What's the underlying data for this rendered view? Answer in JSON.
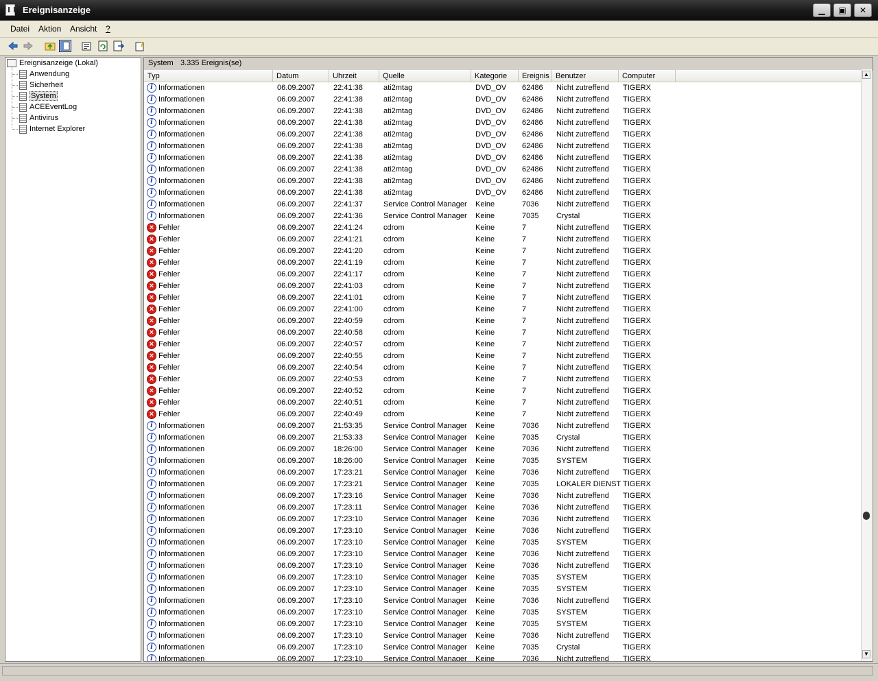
{
  "window": {
    "title": "Ereignisanzeige",
    "buttons": {
      "minimize": "▁",
      "maximize": "▣",
      "close": "✕"
    }
  },
  "menu": {
    "items": [
      {
        "label": "Datei",
        "accel": "D"
      },
      {
        "label": "Aktion",
        "accel": "k"
      },
      {
        "label": "Ansicht",
        "accel": "A"
      },
      {
        "label": "?",
        "accel": "?"
      }
    ]
  },
  "toolbar": {
    "icons": [
      "back-arrow-icon",
      "forward-arrow-icon",
      "up-folder-icon",
      "show-hide-tree-icon",
      "properties-icon",
      "refresh-icon",
      "export-list-icon",
      "help-icon"
    ]
  },
  "tree": {
    "root": "Ereignisanzeige (Lokal)",
    "items": [
      "Anwendung",
      "Sicherheit",
      "System",
      "ACEEventLog",
      "Antivirus",
      "Internet Explorer"
    ],
    "selected": "System"
  },
  "header": {
    "log_name": "System",
    "count_text": "3.335 Ereignis(se)"
  },
  "columns": [
    "Typ",
    "Datum",
    "Uhrzeit",
    "Quelle",
    "Kategorie",
    "Ereignis",
    "Benutzer",
    "Computer"
  ],
  "rows": [
    [
      "Informationen",
      "06.09.2007",
      "22:41:38",
      "ati2mtag",
      "DVD_OV",
      "62486",
      "Nicht zutreffend",
      "TIGERX"
    ],
    [
      "Informationen",
      "06.09.2007",
      "22:41:38",
      "ati2mtag",
      "DVD_OV",
      "62486",
      "Nicht zutreffend",
      "TIGERX"
    ],
    [
      "Informationen",
      "06.09.2007",
      "22:41:38",
      "ati2mtag",
      "DVD_OV",
      "62486",
      "Nicht zutreffend",
      "TIGERX"
    ],
    [
      "Informationen",
      "06.09.2007",
      "22:41:38",
      "ati2mtag",
      "DVD_OV",
      "62486",
      "Nicht zutreffend",
      "TIGERX"
    ],
    [
      "Informationen",
      "06.09.2007",
      "22:41:38",
      "ati2mtag",
      "DVD_OV",
      "62486",
      "Nicht zutreffend",
      "TIGERX"
    ],
    [
      "Informationen",
      "06.09.2007",
      "22:41:38",
      "ati2mtag",
      "DVD_OV",
      "62486",
      "Nicht zutreffend",
      "TIGERX"
    ],
    [
      "Informationen",
      "06.09.2007",
      "22:41:38",
      "ati2mtag",
      "DVD_OV",
      "62486",
      "Nicht zutreffend",
      "TIGERX"
    ],
    [
      "Informationen",
      "06.09.2007",
      "22:41:38",
      "ati2mtag",
      "DVD_OV",
      "62486",
      "Nicht zutreffend",
      "TIGERX"
    ],
    [
      "Informationen",
      "06.09.2007",
      "22:41:38",
      "ati2mtag",
      "DVD_OV",
      "62486",
      "Nicht zutreffend",
      "TIGERX"
    ],
    [
      "Informationen",
      "06.09.2007",
      "22:41:38",
      "ati2mtag",
      "DVD_OV",
      "62486",
      "Nicht zutreffend",
      "TIGERX"
    ],
    [
      "Informationen",
      "06.09.2007",
      "22:41:37",
      "Service Control Manager",
      "Keine",
      "7036",
      "Nicht zutreffend",
      "TIGERX"
    ],
    [
      "Informationen",
      "06.09.2007",
      "22:41:36",
      "Service Control Manager",
      "Keine",
      "7035",
      "Crystal",
      "TIGERX"
    ],
    [
      "Fehler",
      "06.09.2007",
      "22:41:24",
      "cdrom",
      "Keine",
      "7",
      "Nicht zutreffend",
      "TIGERX"
    ],
    [
      "Fehler",
      "06.09.2007",
      "22:41:21",
      "cdrom",
      "Keine",
      "7",
      "Nicht zutreffend",
      "TIGERX"
    ],
    [
      "Fehler",
      "06.09.2007",
      "22:41:20",
      "cdrom",
      "Keine",
      "7",
      "Nicht zutreffend",
      "TIGERX"
    ],
    [
      "Fehler",
      "06.09.2007",
      "22:41:19",
      "cdrom",
      "Keine",
      "7",
      "Nicht zutreffend",
      "TIGERX"
    ],
    [
      "Fehler",
      "06.09.2007",
      "22:41:17",
      "cdrom",
      "Keine",
      "7",
      "Nicht zutreffend",
      "TIGERX"
    ],
    [
      "Fehler",
      "06.09.2007",
      "22:41:03",
      "cdrom",
      "Keine",
      "7",
      "Nicht zutreffend",
      "TIGERX"
    ],
    [
      "Fehler",
      "06.09.2007",
      "22:41:01",
      "cdrom",
      "Keine",
      "7",
      "Nicht zutreffend",
      "TIGERX"
    ],
    [
      "Fehler",
      "06.09.2007",
      "22:41:00",
      "cdrom",
      "Keine",
      "7",
      "Nicht zutreffend",
      "TIGERX"
    ],
    [
      "Fehler",
      "06.09.2007",
      "22:40:59",
      "cdrom",
      "Keine",
      "7",
      "Nicht zutreffend",
      "TIGERX"
    ],
    [
      "Fehler",
      "06.09.2007",
      "22:40:58",
      "cdrom",
      "Keine",
      "7",
      "Nicht zutreffend",
      "TIGERX"
    ],
    [
      "Fehler",
      "06.09.2007",
      "22:40:57",
      "cdrom",
      "Keine",
      "7",
      "Nicht zutreffend",
      "TIGERX"
    ],
    [
      "Fehler",
      "06.09.2007",
      "22:40:55",
      "cdrom",
      "Keine",
      "7",
      "Nicht zutreffend",
      "TIGERX"
    ],
    [
      "Fehler",
      "06.09.2007",
      "22:40:54",
      "cdrom",
      "Keine",
      "7",
      "Nicht zutreffend",
      "TIGERX"
    ],
    [
      "Fehler",
      "06.09.2007",
      "22:40:53",
      "cdrom",
      "Keine",
      "7",
      "Nicht zutreffend",
      "TIGERX"
    ],
    [
      "Fehler",
      "06.09.2007",
      "22:40:52",
      "cdrom",
      "Keine",
      "7",
      "Nicht zutreffend",
      "TIGERX"
    ],
    [
      "Fehler",
      "06.09.2007",
      "22:40:51",
      "cdrom",
      "Keine",
      "7",
      "Nicht zutreffend",
      "TIGERX"
    ],
    [
      "Fehler",
      "06.09.2007",
      "22:40:49",
      "cdrom",
      "Keine",
      "7",
      "Nicht zutreffend",
      "TIGERX"
    ],
    [
      "Informationen",
      "06.09.2007",
      "21:53:35",
      "Service Control Manager",
      "Keine",
      "7036",
      "Nicht zutreffend",
      "TIGERX"
    ],
    [
      "Informationen",
      "06.09.2007",
      "21:53:33",
      "Service Control Manager",
      "Keine",
      "7035",
      "Crystal",
      "TIGERX"
    ],
    [
      "Informationen",
      "06.09.2007",
      "18:26:00",
      "Service Control Manager",
      "Keine",
      "7036",
      "Nicht zutreffend",
      "TIGERX"
    ],
    [
      "Informationen",
      "06.09.2007",
      "18:26:00",
      "Service Control Manager",
      "Keine",
      "7035",
      "SYSTEM",
      "TIGERX"
    ],
    [
      "Informationen",
      "06.09.2007",
      "17:23:21",
      "Service Control Manager",
      "Keine",
      "7036",
      "Nicht zutreffend",
      "TIGERX"
    ],
    [
      "Informationen",
      "06.09.2007",
      "17:23:21",
      "Service Control Manager",
      "Keine",
      "7035",
      "LOKALER DIENST",
      "TIGERX"
    ],
    [
      "Informationen",
      "06.09.2007",
      "17:23:16",
      "Service Control Manager",
      "Keine",
      "7036",
      "Nicht zutreffend",
      "TIGERX"
    ],
    [
      "Informationen",
      "06.09.2007",
      "17:23:11",
      "Service Control Manager",
      "Keine",
      "7036",
      "Nicht zutreffend",
      "TIGERX"
    ],
    [
      "Informationen",
      "06.09.2007",
      "17:23:10",
      "Service Control Manager",
      "Keine",
      "7036",
      "Nicht zutreffend",
      "TIGERX"
    ],
    [
      "Informationen",
      "06.09.2007",
      "17:23:10",
      "Service Control Manager",
      "Keine",
      "7036",
      "Nicht zutreffend",
      "TIGERX"
    ],
    [
      "Informationen",
      "06.09.2007",
      "17:23:10",
      "Service Control Manager",
      "Keine",
      "7035",
      "SYSTEM",
      "TIGERX"
    ],
    [
      "Informationen",
      "06.09.2007",
      "17:23:10",
      "Service Control Manager",
      "Keine",
      "7036",
      "Nicht zutreffend",
      "TIGERX"
    ],
    [
      "Informationen",
      "06.09.2007",
      "17:23:10",
      "Service Control Manager",
      "Keine",
      "7036",
      "Nicht zutreffend",
      "TIGERX"
    ],
    [
      "Informationen",
      "06.09.2007",
      "17:23:10",
      "Service Control Manager",
      "Keine",
      "7035",
      "SYSTEM",
      "TIGERX"
    ],
    [
      "Informationen",
      "06.09.2007",
      "17:23:10",
      "Service Control Manager",
      "Keine",
      "7035",
      "SYSTEM",
      "TIGERX"
    ],
    [
      "Informationen",
      "06.09.2007",
      "17:23:10",
      "Service Control Manager",
      "Keine",
      "7036",
      "Nicht zutreffend",
      "TIGERX"
    ],
    [
      "Informationen",
      "06.09.2007",
      "17:23:10",
      "Service Control Manager",
      "Keine",
      "7035",
      "SYSTEM",
      "TIGERX"
    ],
    [
      "Informationen",
      "06.09.2007",
      "17:23:10",
      "Service Control Manager",
      "Keine",
      "7035",
      "SYSTEM",
      "TIGERX"
    ],
    [
      "Informationen",
      "06.09.2007",
      "17:23:10",
      "Service Control Manager",
      "Keine",
      "7036",
      "Nicht zutreffend",
      "TIGERX"
    ],
    [
      "Informationen",
      "06.09.2007",
      "17:23:10",
      "Service Control Manager",
      "Keine",
      "7035",
      "Crystal",
      "TIGERX"
    ],
    [
      "Informationen",
      "06.09.2007",
      "17:23:10",
      "Service Control Manager",
      "Keine",
      "7036",
      "Nicht zutreffend",
      "TIGERX"
    ]
  ],
  "colors": {
    "info_icon": "#1c3a9a",
    "error_icon": "#d8201b"
  }
}
